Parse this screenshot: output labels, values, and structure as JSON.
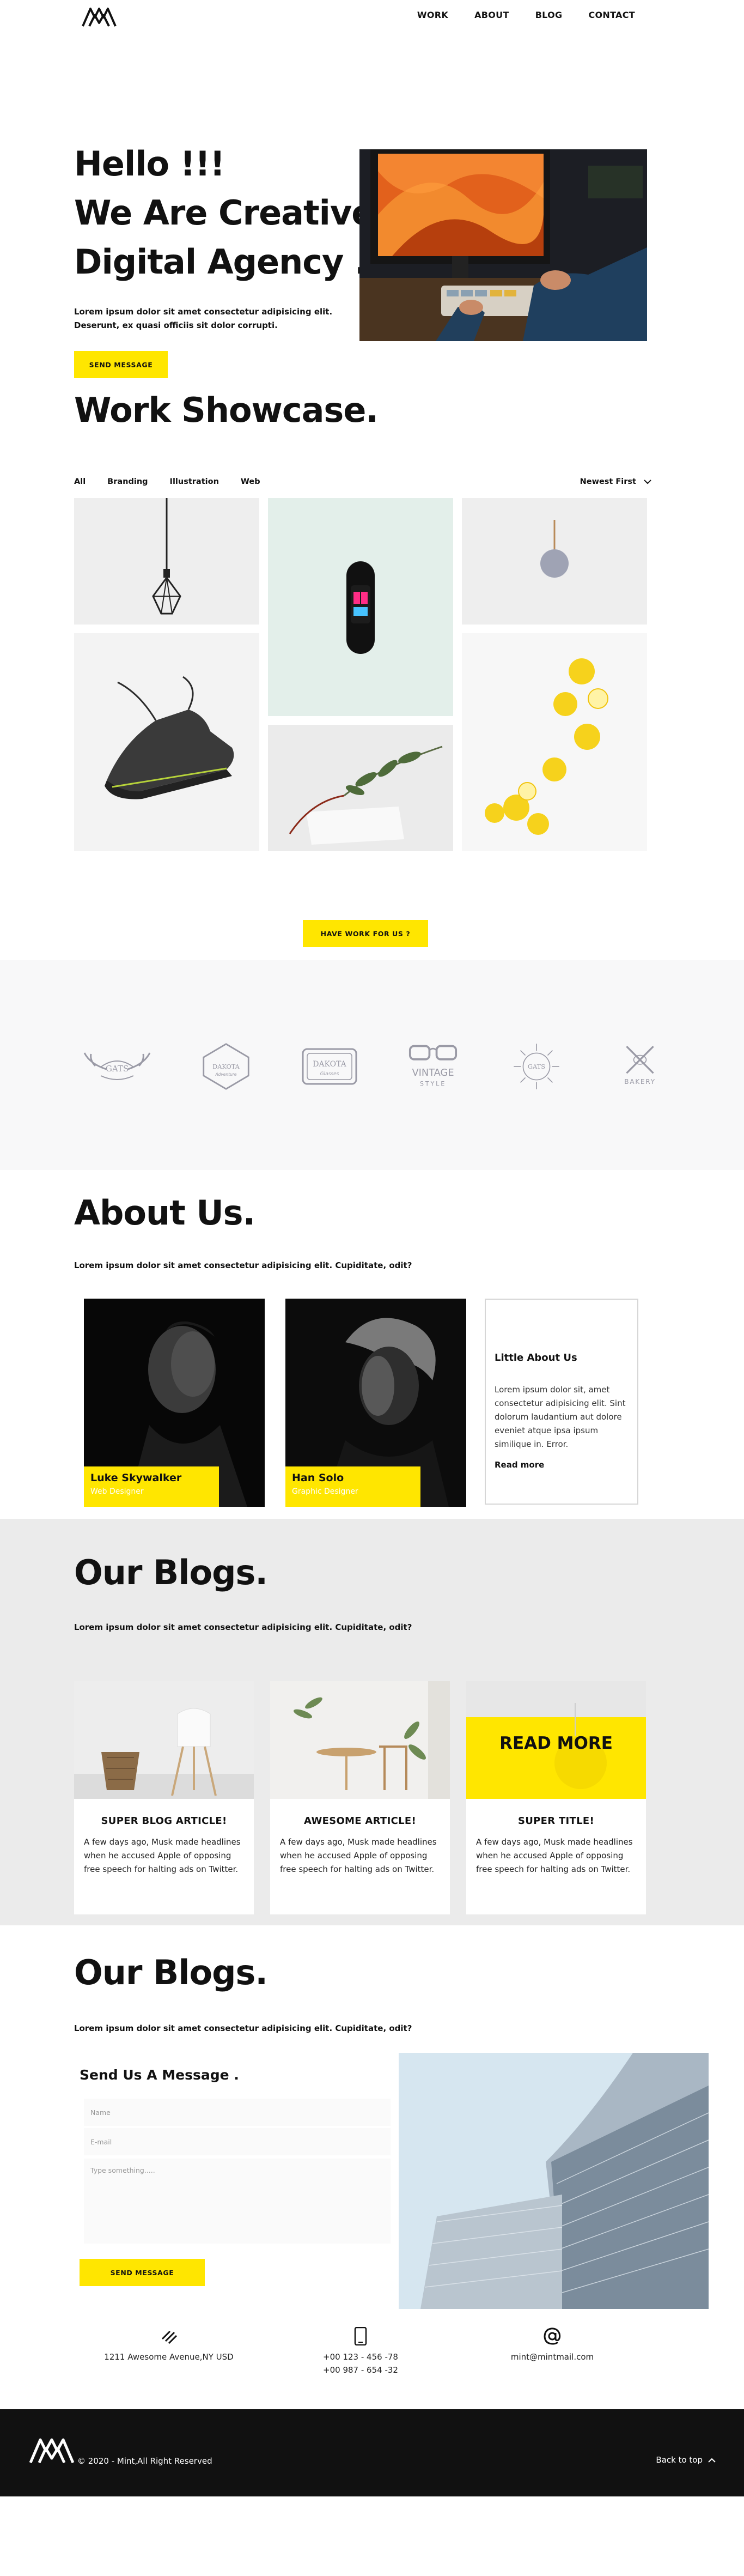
{
  "header": {
    "nav": [
      "WORK",
      "ABOUT",
      "BLOG",
      "CONTACT"
    ]
  },
  "hero": {
    "title_lines": [
      "Hello !!!",
      "We Are Creative",
      "Digital Agency ."
    ],
    "lead": "Lorem ipsum dolor sit amet consectetur adipisicing elit. Deserunt, ex quasi officiis sit dolor corrupti.",
    "cta": "SEND MESSAGE"
  },
  "work": {
    "title": "Work Showcase.",
    "filters": [
      "All",
      "Branding",
      "Illustration",
      "Web"
    ],
    "sort": "Newest First",
    "cta": "HAVE WORK FOR US ?"
  },
  "clients": [
    {
      "name": "GATS",
      "sub": ""
    },
    {
      "name": "DAKOTA",
      "sub": "Adventure"
    },
    {
      "name": "DAKOTA",
      "sub": "Glasses"
    },
    {
      "name": "VINTAGE",
      "sub": "STYLE"
    },
    {
      "name": "GATS",
      "sub": ""
    },
    {
      "name": "BAKERY",
      "sub": ""
    }
  ],
  "about": {
    "title": "About Us.",
    "sub": "Lorem ipsum dolor sit amet consectetur adipisicing elit. Cupiditate, odit?",
    "people": [
      {
        "name": "Luke Skywalker",
        "role": "Web Designer"
      },
      {
        "name": "Han Solo",
        "role": "Graphic Designer"
      }
    ],
    "card": {
      "title": "Little About Us",
      "text": "Lorem ipsum dolor sit, amet consectetur adipisicing elit. Sint dolorum laudantium aut dolore eveniet atque ipsa ipsum similique in. Error.",
      "more": "Read more"
    }
  },
  "blogs": {
    "title": "Our Blogs.",
    "sub": "Lorem ipsum dolor sit amet consectetur adipisicing elit. Cupiditate, odit?",
    "read_more": "READ MORE",
    "cards": [
      {
        "title": "SUPER BLOG ARTICLE!",
        "text": "A few days ago, Musk made headlines when he accused Apple of opposing free speech for halting ads on Twitter."
      },
      {
        "title": "AWESOME ARTICLE!",
        "text": "A few days ago, Musk made headlines when he accused Apple of opposing free speech for halting ads on Twitter."
      },
      {
        "title": "SUPER TITLE!",
        "text": "A few days ago, Musk made headlines when he accused Apple of opposing free speech for halting ads on Twitter."
      }
    ]
  },
  "contact": {
    "title": "Our Blogs.",
    "sub": "Lorem ipsum dolor sit amet consectetur adipisicing elit. Cupiditate, odit?",
    "form_title": "Send Us A Message .",
    "name_placeholder": "Name",
    "email_placeholder": "E-mail",
    "message_placeholder": "Type something.....",
    "cta": "SEND MESSAGE"
  },
  "info": {
    "address": "1211 Awesome Avenue,NY USD",
    "phone1": "+00 123 - 456 -78",
    "phone2": "+00 987 - 654 -32",
    "email": "mint@mintmail.com"
  },
  "footer": {
    "copyright": "© 2020 - Mint,All Right Reserved",
    "back_to_top": "Back to top"
  },
  "colors": {
    "accent": "#ffe600",
    "dark": "#111111",
    "light_bg": "#ebebeb"
  }
}
